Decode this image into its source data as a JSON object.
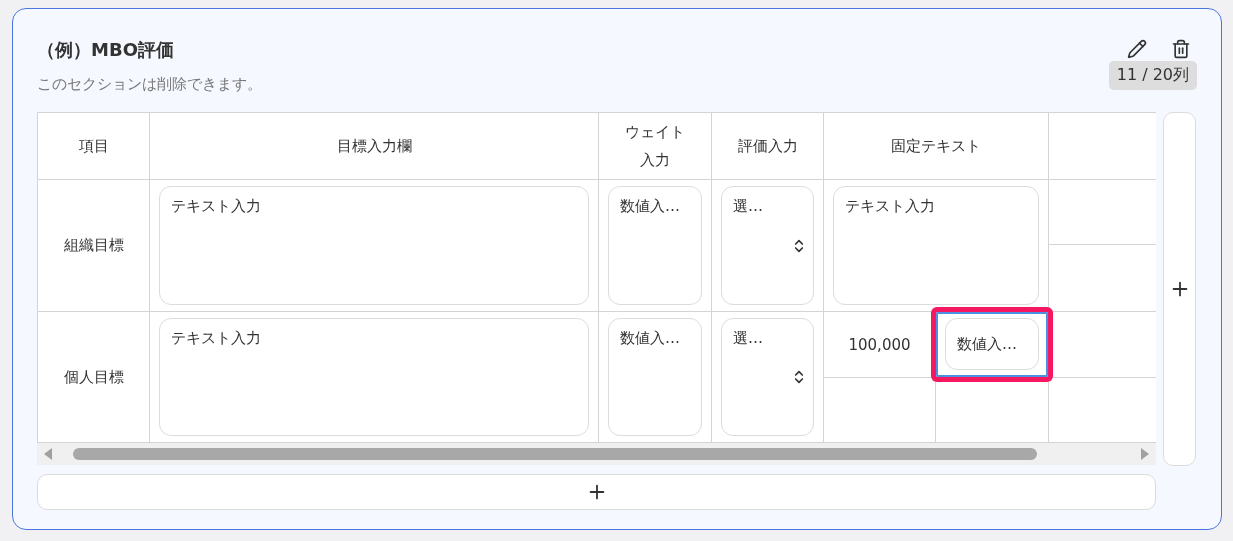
{
  "section": {
    "title": "（例）MBO評価",
    "description": "このセクションは削除できます。",
    "column_count": "11 / 20列"
  },
  "table": {
    "columns": [
      {
        "label": "項目"
      },
      {
        "label": "目標入力欄"
      },
      {
        "label": "ウェイト入力"
      },
      {
        "label": "評価入力"
      },
      {
        "label": "固定テキスト"
      }
    ],
    "rows": [
      {
        "item": "組織目標",
        "goal": {
          "placeholder": "テキスト入力"
        },
        "weight": {
          "placeholder": "数値入…"
        },
        "evaluation": {
          "placeholder": "選…"
        },
        "fixed": {
          "kind": "textarea",
          "placeholder": "テキスト入力"
        }
      },
      {
        "item": "個人目標",
        "goal": {
          "placeholder": "テキスト入力"
        },
        "weight": {
          "placeholder": "数値入…"
        },
        "evaluation": {
          "placeholder": "選…"
        },
        "fixed": {
          "kind": "split",
          "text": "100,000",
          "input": {
            "placeholder": "数値入…",
            "selected": true
          }
        }
      }
    ]
  }
}
